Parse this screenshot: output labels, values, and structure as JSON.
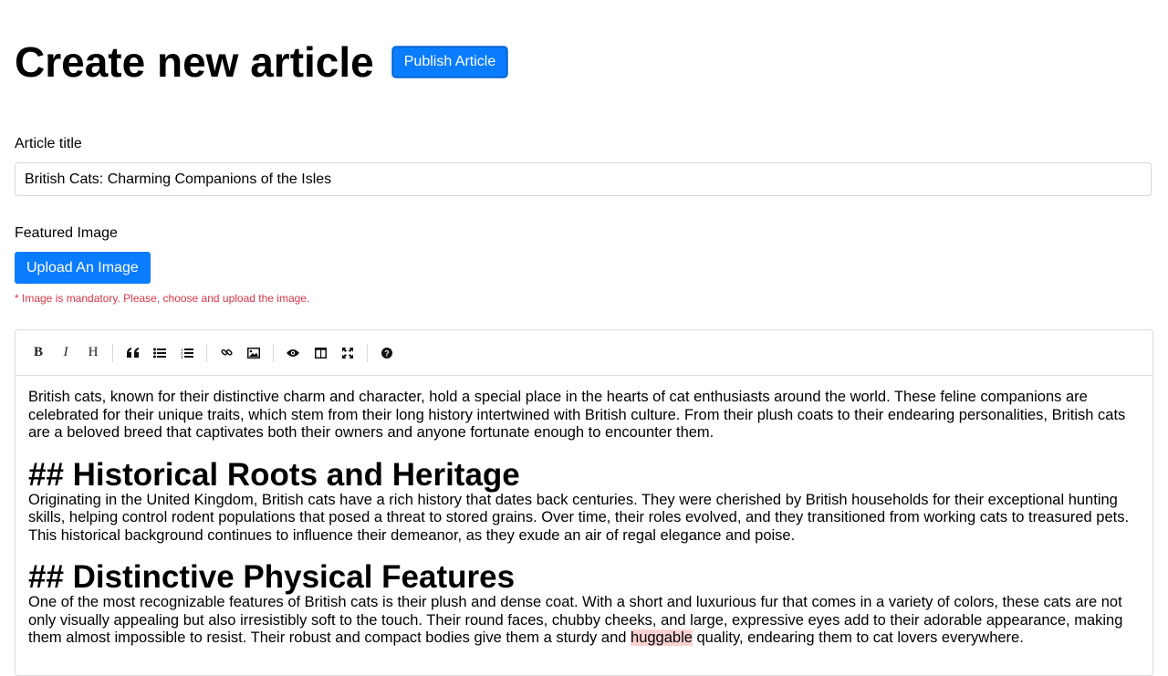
{
  "header": {
    "title": "Create new article",
    "publish_label": "Publish Article"
  },
  "form": {
    "title_label": "Article title",
    "title_value": "British Cats: Charming Companions of the Isles",
    "image_label": "Featured Image",
    "upload_label": "Upload An Image",
    "image_error": "* Image is mandatory. Please, choose and upload the image."
  },
  "toolbar": {
    "bold": "B",
    "italic": "I",
    "heading": "H",
    "icons": [
      "bold-icon",
      "italic-icon",
      "heading-icon",
      "quote-icon",
      "unordered-list-icon",
      "ordered-list-icon",
      "link-icon",
      "image-icon",
      "preview-icon",
      "side-by-side-icon",
      "fullscreen-icon",
      "help-icon"
    ]
  },
  "content": {
    "p1": "British cats, known for their distinctive charm and character, hold a special place in the hearts of cat enthusiasts around the world. These feline companions are celebrated for their unique traits, which stem from their long history intertwined with British culture. From their plush coats to their endearing personalities, British cats are a beloved breed that captivates both their owners and anyone fortunate enough to encounter them.",
    "h1": "## Historical Roots and Heritage",
    "p2": "Originating in the United Kingdom, British cats have a rich history that dates back centuries. They were cherished by British households for their exceptional hunting skills, helping control rodent populations that posed a threat to stored grains. Over time, their roles evolved, and they transitioned from working cats to treasured pets. This historical background continues to influence their demeanor, as they exude an air of regal elegance and poise.",
    "h2": "## Distinctive Physical Features",
    "p3_before": "One of the most recognizable features of British cats is their plush and dense coat. With a short and luxurious fur that comes in a variety of colors, these cats are not only visually appealing but also irresistibly soft to the touch. Their round faces, chubby cheeks, and large, expressive eyes add to their adorable appearance, making them almost impossible to resist. Their robust and compact bodies give them a sturdy and ",
    "p3_misspelled": "huggable",
    "p3_after": " quality, endearing them to cat lovers everywhere."
  },
  "colors": {
    "primary": "#0a7cff",
    "error": "#dc3545",
    "misspelling_highlight": "#fbd2d2"
  }
}
